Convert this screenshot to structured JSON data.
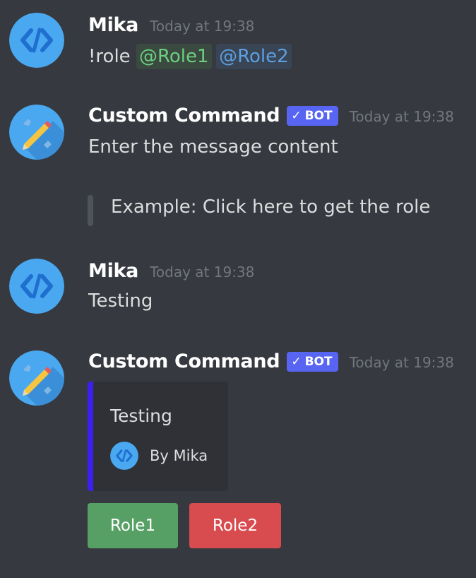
{
  "messages": [
    {
      "author": "Mika",
      "timestamp": "Today at 19:38",
      "text_prefix": "!role ",
      "mentions": [
        "@Role1",
        "@Role2"
      ]
    },
    {
      "author": "Custom Command",
      "bot_tag": "BOT",
      "timestamp": "Today at 19:38",
      "text": "Enter the message content",
      "quote": "Example: Click here to get the role"
    },
    {
      "author": "Mika",
      "timestamp": "Today at 19:38",
      "text": "Testing"
    },
    {
      "author": "Custom Command",
      "bot_tag": "BOT",
      "timestamp": "Today at 19:38",
      "embed": {
        "title": "Testing",
        "footer": "By Mika",
        "bar_color": "#3d1ff2"
      },
      "buttons": [
        {
          "label": "Role1",
          "color": "#57a065"
        },
        {
          "label": "Role2",
          "color": "#d84b4f"
        }
      ]
    }
  ],
  "icons": {
    "user_avatar": "code-brackets-icon",
    "bot_avatar": "pencil-wrench-icon",
    "bot_check": "checkmark-icon"
  },
  "colors": {
    "background": "#36393f",
    "bot_tag": "#5865f2",
    "mention_green": "#6ccf7f",
    "mention_blue": "#5d9fe0"
  }
}
